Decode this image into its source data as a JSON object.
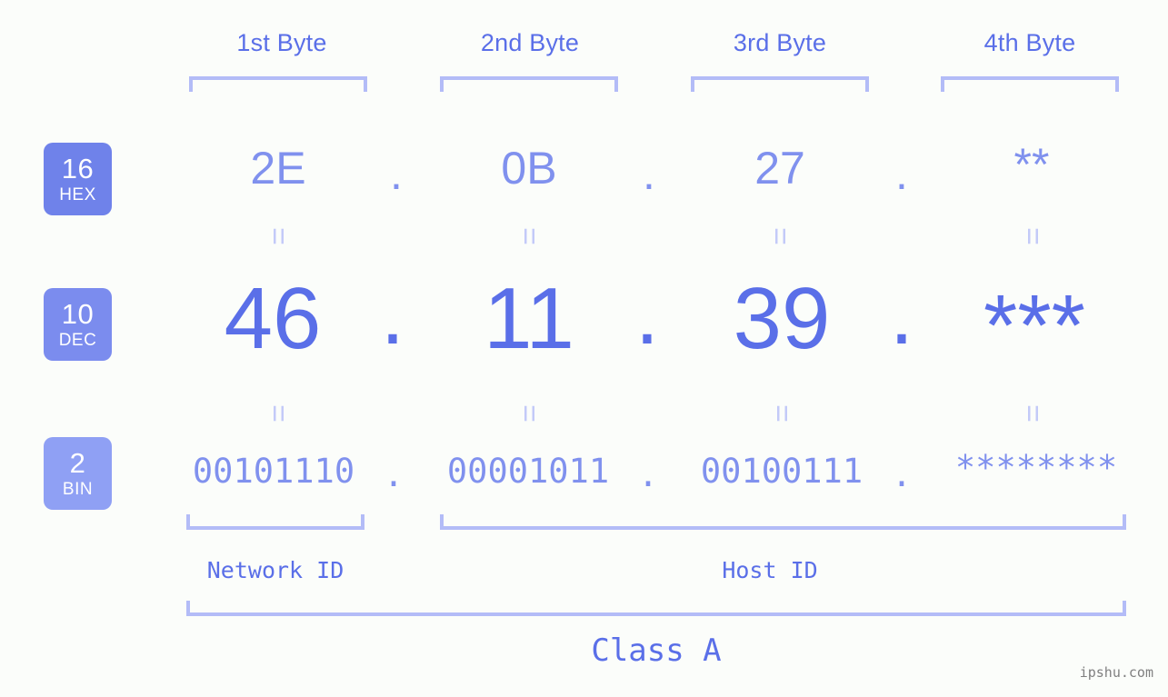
{
  "meta": {
    "accent_strong": "#5a6fe8",
    "accent_light": "#8091ee",
    "bracket_color": "#b3bcf7",
    "connector_color": "#c3caf8",
    "background": "#fbfdfa",
    "badge_hex_bg": "#6f82ea",
    "badge_dec_bg": "#7b8cee",
    "badge_bin_bg": "#8fa0f4"
  },
  "byte_headers": [
    {
      "label": "1st Byte"
    },
    {
      "label": "2nd Byte"
    },
    {
      "label": "3rd Byte"
    },
    {
      "label": "4th Byte"
    }
  ],
  "radix_badges": [
    {
      "base": "16",
      "name": "HEX"
    },
    {
      "base": "10",
      "name": "DEC"
    },
    {
      "base": "2",
      "name": "BIN"
    }
  ],
  "rows": {
    "hex": {
      "base": "16",
      "name": "HEX",
      "values": [
        "2E",
        "0B",
        "27",
        "**"
      ],
      "separator": "."
    },
    "dec": {
      "base": "10",
      "name": "DEC",
      "values": [
        "46",
        "11",
        "39",
        "***"
      ],
      "separator": "."
    },
    "bin": {
      "base": "2",
      "name": "BIN",
      "values": [
        "00101110",
        "00001011",
        "00100111",
        "********"
      ],
      "separator": "."
    }
  },
  "connector_symbol": "=",
  "id_sections": [
    {
      "label": "Network ID"
    },
    {
      "label": "Host ID"
    }
  ],
  "class_section": {
    "label": "Class A"
  },
  "watermark": {
    "text": "ipshu.com"
  }
}
